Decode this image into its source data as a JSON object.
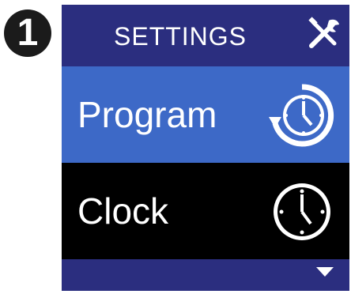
{
  "step_number": "1",
  "screen": {
    "header": {
      "title": "SETTINGS",
      "icon": "settings-tools-icon"
    },
    "menu": [
      {
        "label": "Program",
        "icon": "program-clock-icon",
        "selected": true
      },
      {
        "label": "Clock",
        "icon": "clock-icon",
        "selected": false
      }
    ],
    "footer": {
      "icon": "scroll-down-arrow-icon"
    }
  },
  "colors": {
    "header_bg": "#2b2e7f",
    "selected_bg": "#3d69c7",
    "normal_bg": "#000000",
    "text": "#ffffff"
  }
}
